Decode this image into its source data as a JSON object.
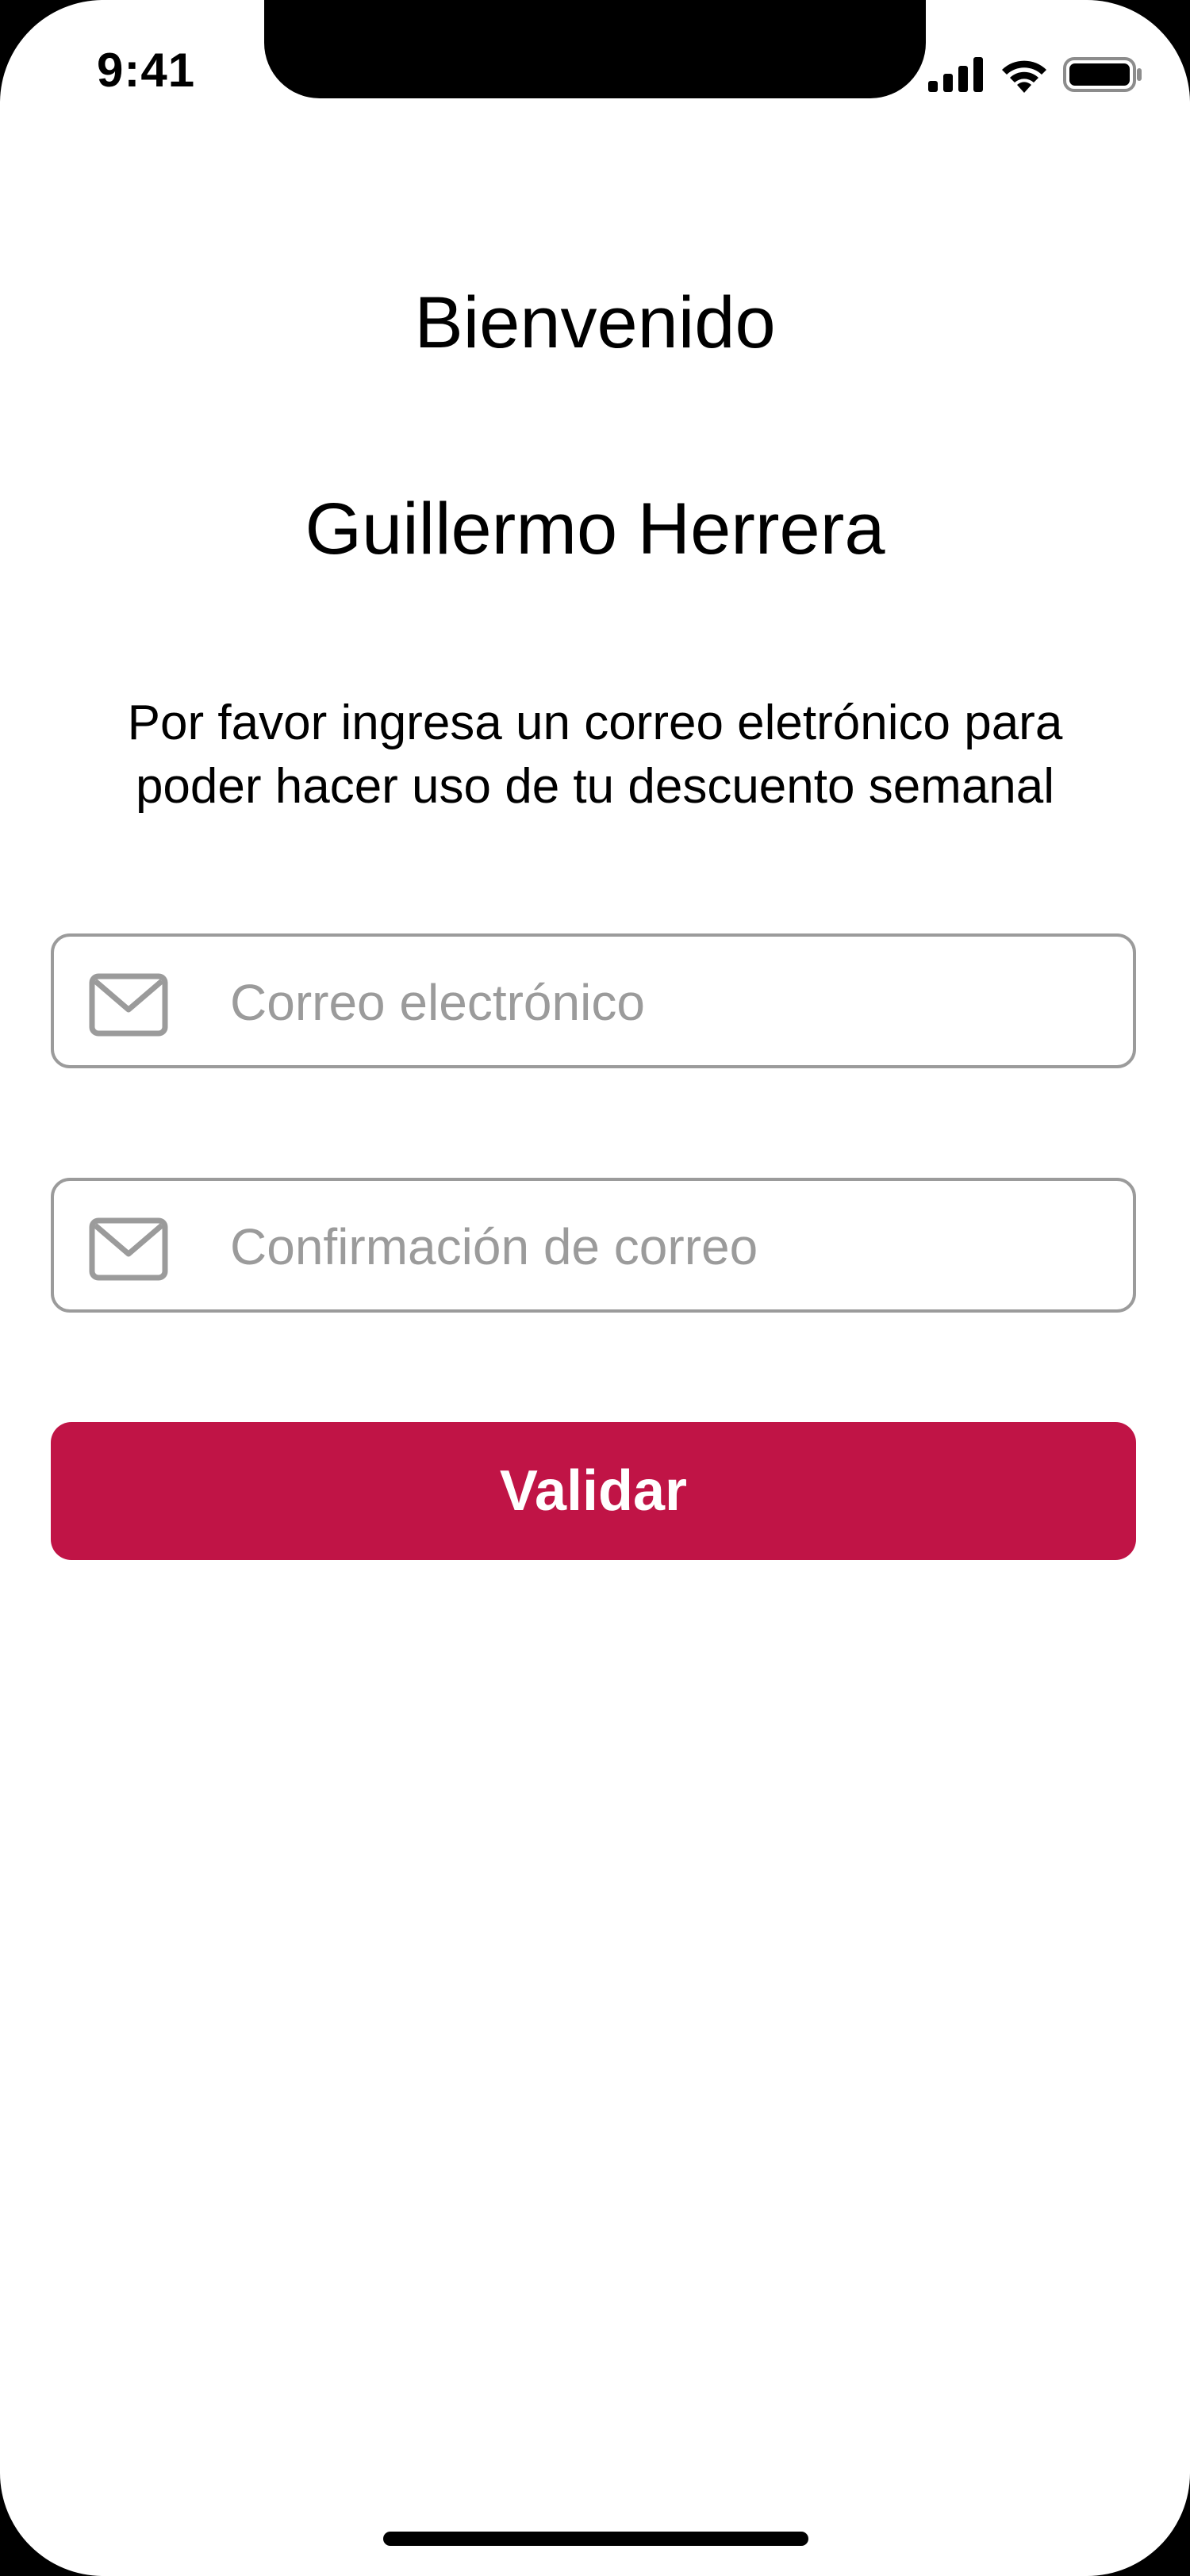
{
  "status_bar": {
    "time": "9:41",
    "icons": [
      "cellular-signal-icon",
      "wifi-icon",
      "battery-icon"
    ]
  },
  "welcome": {
    "title": "Bienvenido",
    "user_name": "Guillermo Herrera",
    "description": "Por favor ingresa un correo eletrónico para poder hacer uso de tu descuento semanal"
  },
  "form": {
    "email": {
      "icon": "mail-icon",
      "value": "",
      "placeholder": "Correo electrónico"
    },
    "email_confirm": {
      "icon": "mail-icon",
      "value": "",
      "placeholder": "Confirmación de correo"
    },
    "submit_label": "Validar"
  },
  "colors": {
    "accent": "#c01446",
    "border": "#9b9b9b",
    "placeholder": "#9b9b9b",
    "background": "#ffffff"
  }
}
